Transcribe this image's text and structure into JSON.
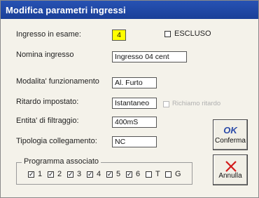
{
  "window": {
    "title": "Modifica parametri ingressi"
  },
  "fields": {
    "ingresso_label": "Ingresso in esame:",
    "ingresso_value": "4",
    "escluso_label": "ESCLUSO",
    "nomina_label": "Nomina ingresso",
    "nomina_value": "Ingresso 04 cent",
    "modalita_label": "Modalita' funzionamento",
    "modalita_value": "Al. Furto",
    "ritardo_label": "Ritardo impostato:",
    "ritardo_value": "Istantaneo",
    "richiamo_label": "Richiamo ritardo",
    "filtraggio_label": "Entita' di filtraggio:",
    "filtraggio_value": "400mS",
    "tipologia_label": "Tipologia collegamento:",
    "tipologia_value": "NC"
  },
  "buttons": {
    "ok_icon": "OK",
    "ok_label": "Conferma",
    "cancel_icon": "✕",
    "cancel_label": "Annulla"
  },
  "programma": {
    "legend": "Programma associato",
    "items": [
      {
        "label": "1",
        "checked": true
      },
      {
        "label": "2",
        "checked": true
      },
      {
        "label": "3",
        "checked": true
      },
      {
        "label": "4",
        "checked": true
      },
      {
        "label": "5",
        "checked": true
      },
      {
        "label": "6",
        "checked": true
      },
      {
        "label": "T",
        "checked": false
      },
      {
        "label": "G",
        "checked": false
      }
    ]
  },
  "check_mark": "✓"
}
